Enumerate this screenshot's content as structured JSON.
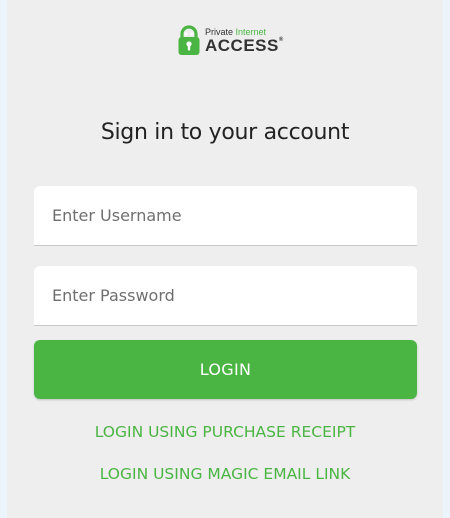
{
  "brand": {
    "logo_line1_part1": "Private",
    "logo_line1_part2": "Internet",
    "logo_line2": "ACCESS",
    "registered_mark": "®",
    "logo_icon": "padlock-robot-icon",
    "accent_color": "#4bb543"
  },
  "form": {
    "heading": "Sign in to your account",
    "username_placeholder": "Enter Username",
    "username_value": "",
    "password_placeholder": "Enter Password",
    "password_value": "",
    "login_label": "LOGIN"
  },
  "alt_logins": {
    "purchase_receipt_label": "LOGIN USING PURCHASE RECEIPT",
    "magic_email_label": "LOGIN USING MAGIC EMAIL LINK"
  }
}
